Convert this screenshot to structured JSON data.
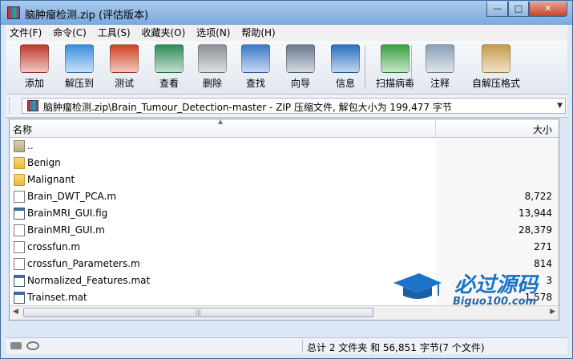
{
  "window": {
    "title": "脑肿瘤检测.zip (评估版本)",
    "min_glyph": "—",
    "max_glyph": "□",
    "close_glyph": "✕"
  },
  "menu": [
    "文件(F)",
    "命令(C)",
    "工具(S)",
    "收藏夹(O)",
    "选项(N)",
    "帮助(H)"
  ],
  "toolbar": [
    {
      "label": "添加",
      "icon": "books-add-icon",
      "color": "#c0392b"
    },
    {
      "label": "解压到",
      "icon": "folder-extract-icon",
      "color": "#3a8ee0"
    },
    {
      "label": "测试",
      "icon": "clipboard-check-icon",
      "color": "#d04020"
    },
    {
      "label": "查看",
      "icon": "book-open-icon",
      "color": "#2e8b57"
    },
    {
      "label": "删除",
      "icon": "trash-icon",
      "color": "#8a9098"
    },
    {
      "label": "查找",
      "icon": "magnifier-icon",
      "color": "#3a78c8"
    },
    {
      "label": "向导",
      "icon": "wand-icon",
      "color": "#6a7a90"
    },
    {
      "label": "信息",
      "icon": "info-icon",
      "color": "#2a6fc0"
    },
    {
      "label": "扫描病毒",
      "icon": "bug-scan-icon",
      "color": "#3aa040"
    },
    {
      "label": "注释",
      "icon": "comment-scroll-icon",
      "color": "#8aa0b8"
    },
    {
      "label": "自解压格式",
      "icon": "box-sfx-icon",
      "color": "#c89a48"
    }
  ],
  "address": {
    "path": "脑肿瘤检测.zip\\Brain_Tumour_Detection-master - ZIP 压缩文件, 解包大小为 199,477 字节",
    "dropdown": "▼"
  },
  "columns": {
    "name": "名称",
    "size": "大小",
    "sort_glyph": "▲"
  },
  "files": [
    {
      "name": "..",
      "size": "",
      "type": "updir"
    },
    {
      "name": "Benign",
      "size": "",
      "type": "folder"
    },
    {
      "name": "Malignant",
      "size": "",
      "type": "folder"
    },
    {
      "name": "Brain_DWT_PCA.m",
      "size": "8,722",
      "type": "m"
    },
    {
      "name": "BrainMRI_GUI.fig",
      "size": "13,944",
      "type": "fig"
    },
    {
      "name": "BrainMRI_GUI.m",
      "size": "28,379",
      "type": "m"
    },
    {
      "name": "crossfun.m",
      "size": "271",
      "type": "m"
    },
    {
      "name": "crossfun_Parameters.m",
      "size": "814",
      "type": "m"
    },
    {
      "name": "Normalized_Features.mat",
      "size": "3",
      "type": "fig"
    },
    {
      "name": "Trainset.mat",
      "size": "1,578",
      "type": "fig"
    }
  ],
  "scroll": {
    "left": "◀",
    "right": "▶",
    "grip": "|||"
  },
  "status": {
    "text": "总计 2 文件夹 和 56,851 字节(7 个文件)"
  },
  "watermark": {
    "title": "必过源码",
    "subtitle": "Biguo100.com"
  }
}
